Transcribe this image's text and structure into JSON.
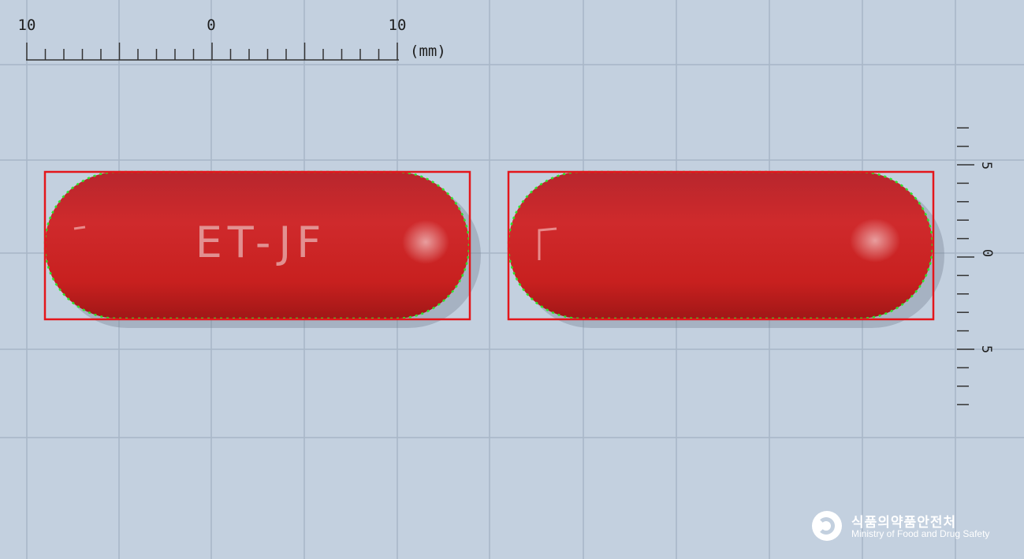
{
  "ruler_top": {
    "left_label": "10",
    "center_label": "0",
    "right_label": "10",
    "unit_label": "(mm)"
  },
  "ruler_side": {
    "upper_label": "5",
    "center_label": "0",
    "lower_label": "5"
  },
  "pills": [
    {
      "id": "front",
      "imprint": "ET-JF"
    },
    {
      "id": "back",
      "imprint": ""
    }
  ],
  "colors": {
    "background": "#c3d0df",
    "grid": "#a8b6c7",
    "pill": "#c4262a",
    "bounding_box": "#e4161b",
    "contour": "#2ee62a"
  },
  "logo": {
    "korean": "식품의약품안전처",
    "english": "Ministry of Food and Drug Safety",
    "icon": "mfds-emblem-icon"
  }
}
